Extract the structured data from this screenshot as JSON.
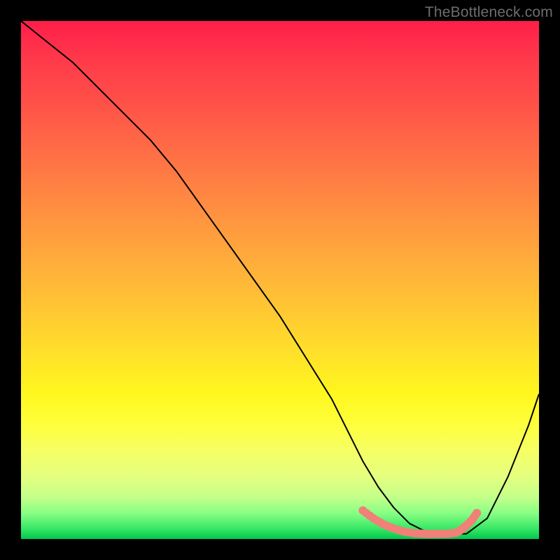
{
  "watermark": "TheBottleneck.com",
  "chart_data": {
    "type": "line",
    "title": "",
    "xlabel": "",
    "ylabel": "",
    "xlim": [
      0,
      100
    ],
    "ylim": [
      0,
      100
    ],
    "grid": false,
    "legend": false,
    "series": [
      {
        "name": "bottleneck-curve",
        "color": "#000000",
        "x": [
          0,
          5,
          10,
          15,
          20,
          25,
          30,
          35,
          40,
          45,
          50,
          55,
          60,
          63,
          66,
          69,
          72,
          75,
          78,
          81,
          83,
          86,
          90,
          94,
          98,
          100
        ],
        "y": [
          100,
          96,
          92,
          87,
          82,
          77,
          71,
          64,
          57,
          50,
          43,
          35,
          27,
          21,
          15,
          10,
          6,
          3,
          1.5,
          1,
          1,
          1,
          4,
          12,
          22,
          28
        ]
      },
      {
        "name": "optimal-range-highlight",
        "color": "#f08078",
        "style": "dotted-thick",
        "x": [
          66,
          68,
          70,
          72,
          74,
          76,
          78,
          80,
          82,
          84,
          85,
          86,
          87,
          88
        ],
        "y": [
          5.5,
          4,
          2.8,
          2,
          1.4,
          1.1,
          1,
          1,
          1,
          1.2,
          1.8,
          2.6,
          3.6,
          5
        ]
      }
    ],
    "background": {
      "type": "vertical-gradient",
      "stops": [
        {
          "pos": 0.0,
          "color": "#ff1e49"
        },
        {
          "pos": 0.4,
          "color": "#ff9a3f"
        },
        {
          "pos": 0.72,
          "color": "#fff71e"
        },
        {
          "pos": 0.95,
          "color": "#88ff84"
        },
        {
          "pos": 1.0,
          "color": "#00c94e"
        }
      ]
    }
  }
}
